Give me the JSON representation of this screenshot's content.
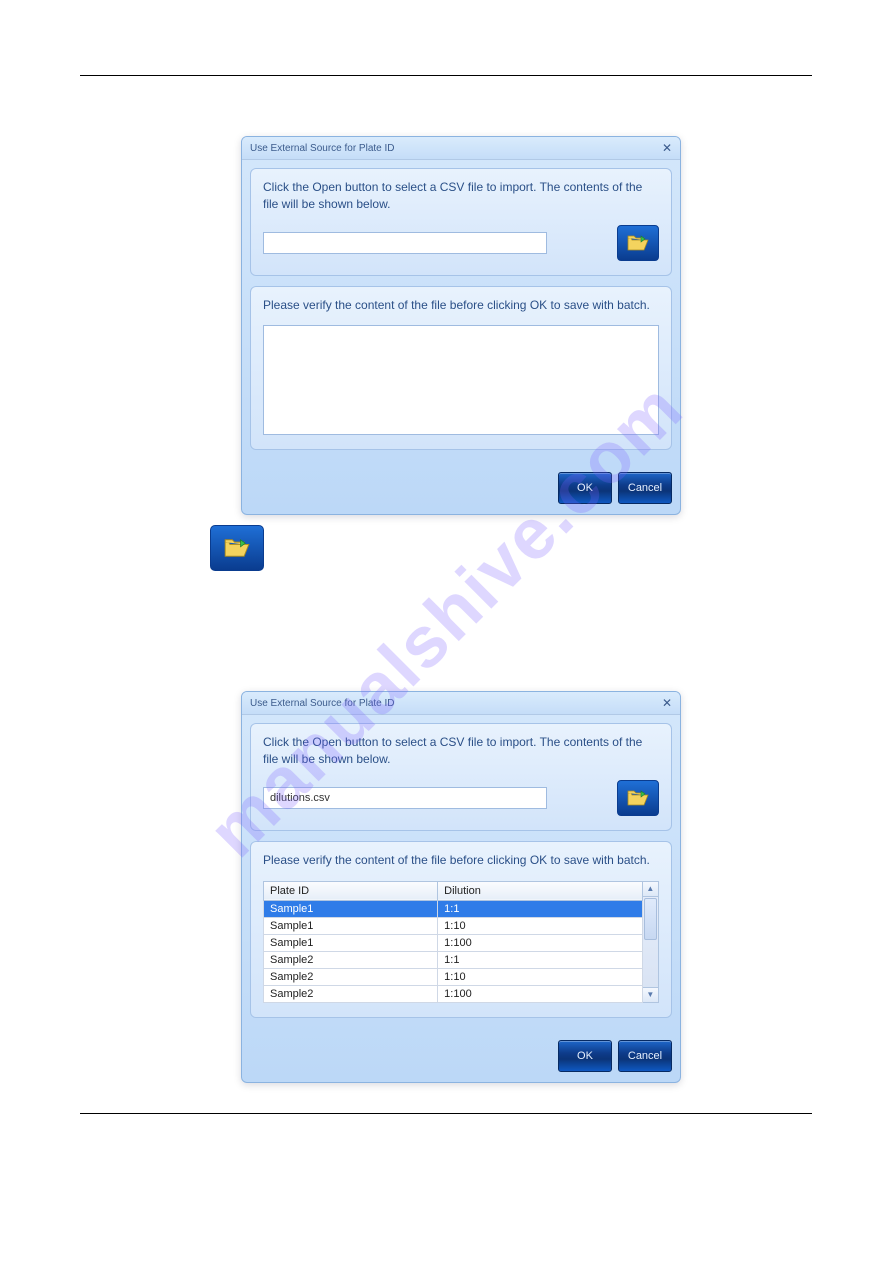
{
  "watermark": "manualshive.com",
  "dialog1": {
    "title": "Use External Source for Plate ID",
    "instruction": "Click the Open button to select a CSV file to import. The contents of the file will be shown below.",
    "file_value": "",
    "verify_text": "Please verify the content of the file before clicking OK to save with batch.",
    "ok_label": "OK",
    "cancel_label": "Cancel"
  },
  "dialog2": {
    "title": "Use External Source for Plate ID",
    "instruction": "Click the Open button to select a CSV file to import. The contents of the file will be shown below.",
    "file_value": "dilutions.csv",
    "verify_text": "Please verify the content of the file before clicking OK to save with batch.",
    "table": {
      "headers": [
        "Plate ID",
        "Dilution"
      ],
      "rows": [
        {
          "plate": "Sample1",
          "dilution": "1:1",
          "highlight": true
        },
        {
          "plate": "Sample1",
          "dilution": "1:10",
          "highlight": false
        },
        {
          "plate": "Sample1",
          "dilution": "1:100",
          "highlight": false
        },
        {
          "plate": "Sample2",
          "dilution": "1:1",
          "highlight": false
        },
        {
          "plate": "Sample2",
          "dilution": "1:10",
          "highlight": false
        },
        {
          "plate": "Sample2",
          "dilution": "1:100",
          "highlight": false
        }
      ]
    },
    "ok_label": "OK",
    "cancel_label": "Cancel"
  }
}
